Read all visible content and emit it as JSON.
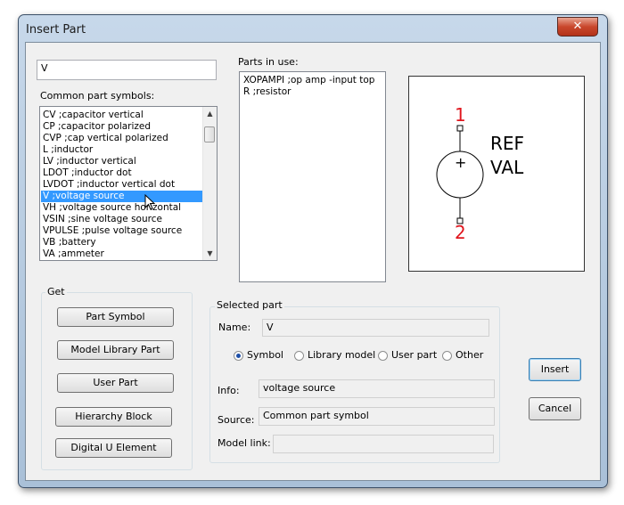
{
  "window": {
    "title": "Insert Part",
    "close_glyph": "✕"
  },
  "search": {
    "value": "V"
  },
  "common": {
    "label": "Common part symbols:",
    "items": [
      {
        "text": "CV  ;capacitor vertical"
      },
      {
        "text": "CP  ;capacitor polarized"
      },
      {
        "text": "CVP  ;cap vertical polarized"
      },
      {
        "text": "L  ;inductor"
      },
      {
        "text": "LV  ;inductor vertical"
      },
      {
        "text": "LDOT  ;inductor dot"
      },
      {
        "text": "LVDOT  ;inductor vertical dot"
      },
      {
        "text": "V  ;voltage source"
      },
      {
        "text": "VH  ;voltage source horizontal"
      },
      {
        "text": "VSIN  ;sine voltage source"
      },
      {
        "text": "VPULSE  ;pulse voltage source"
      },
      {
        "text": "VB  ;battery"
      },
      {
        "text": "VA  ;ammeter"
      }
    ],
    "selected_index": 7
  },
  "parts_in_use": {
    "label": "Parts in use:",
    "items": [
      {
        "text": "XOPAMPI  ;op amp -input top"
      },
      {
        "text": "R  ;resistor"
      }
    ]
  },
  "preview": {
    "pin1": "1",
    "pin2": "2",
    "ref": "REF",
    "val": "VAL",
    "plus": "+"
  },
  "get": {
    "label": "Get",
    "part_symbol": "Part Symbol",
    "model_library_part": "Model Library Part",
    "user_part": "User Part",
    "hierarchy_block": "Hierarchy Block",
    "digital_u_element": "Digital U Element"
  },
  "selected_part": {
    "label": "Selected part",
    "name_label": "Name:",
    "name_value": "V",
    "radios": [
      {
        "label": "Symbol",
        "checked": true
      },
      {
        "label": "Library model",
        "checked": false
      },
      {
        "label": "User part",
        "checked": false
      },
      {
        "label": "Other",
        "checked": false
      }
    ],
    "info_label": "Info:",
    "info_value": "voltage source",
    "source_label": "Source:",
    "source_value": "Common part symbol",
    "model_link_label": "Model link:",
    "model_link_value": ""
  },
  "actions": {
    "insert": "Insert",
    "cancel": "Cancel"
  },
  "colors": {
    "selection": "#3399ff",
    "pin_number": "#e0161e"
  }
}
